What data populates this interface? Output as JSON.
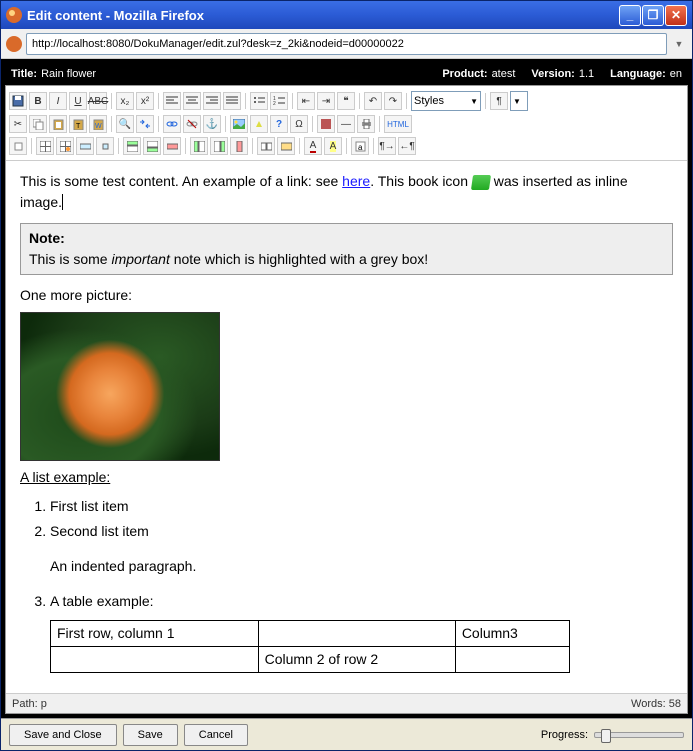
{
  "window": {
    "title": "Edit content - Mozilla Firefox"
  },
  "address": {
    "url": "http://localhost:8080/DokuManager/edit.zul?desk=z_2ki&nodeid=d00000022"
  },
  "infobar": {
    "title_label": "Title:",
    "title_value": "Rain flower",
    "product_label": "Product:",
    "product_value": "atest",
    "version_label": "Version:",
    "version_value": "1.1",
    "language_label": "Language:",
    "language_value": "en"
  },
  "toolbar": {
    "styles_label": "Styles"
  },
  "content": {
    "p1_a": "This is some test content. An example of a link: see ",
    "p1_link": "here",
    "p1_b": ". This book icon ",
    "p1_c": " was inserted as inline image.",
    "note_title": "Note:",
    "note_a": "This is some ",
    "note_i": "important",
    "note_b": " note which is highlighted with a grey box!",
    "p2": "One more picture:",
    "list_header": "A list example:",
    "li1": "First list item",
    "li2": "Second list item",
    "indent": "An indented paragraph.",
    "li3": "A table example:",
    "table": {
      "r1c1": "First row, column 1",
      "r1c2": "",
      "r1c3": "Column3",
      "r2c1": "",
      "r2c2": "Column 2 of row 2",
      "r2c3": ""
    }
  },
  "pathbar": {
    "path_label": "Path:",
    "path_value": "p",
    "words_label": "Words:",
    "words_value": "58"
  },
  "footer": {
    "save_close": "Save and Close",
    "save": "Save",
    "cancel": "Cancel",
    "progress": "Progress:"
  }
}
